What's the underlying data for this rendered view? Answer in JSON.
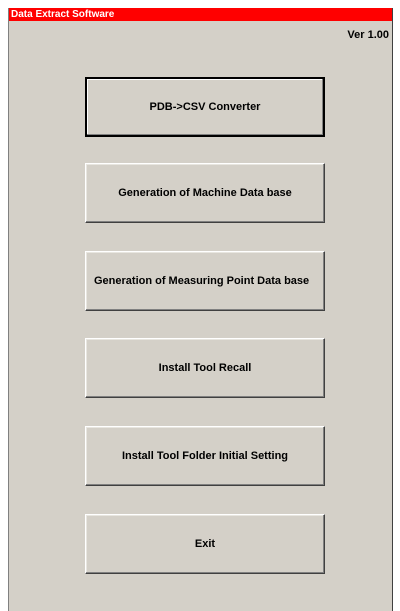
{
  "window": {
    "title": "Data Extract Software",
    "version": "Ver 1.00"
  },
  "buttons": {
    "pdb_csv": "PDB->CSV Converter",
    "machine_db": "Generation of Machine Data base",
    "measuring_point_db": "Generation of Measuring Point Data base",
    "install_tool_recall": "Install Tool Recall",
    "install_tool_folder": "Install Tool Folder Initial Setting",
    "exit": "Exit"
  },
  "colors": {
    "titlebar": "#ff0000",
    "window_bg": "#d4d0c8"
  }
}
